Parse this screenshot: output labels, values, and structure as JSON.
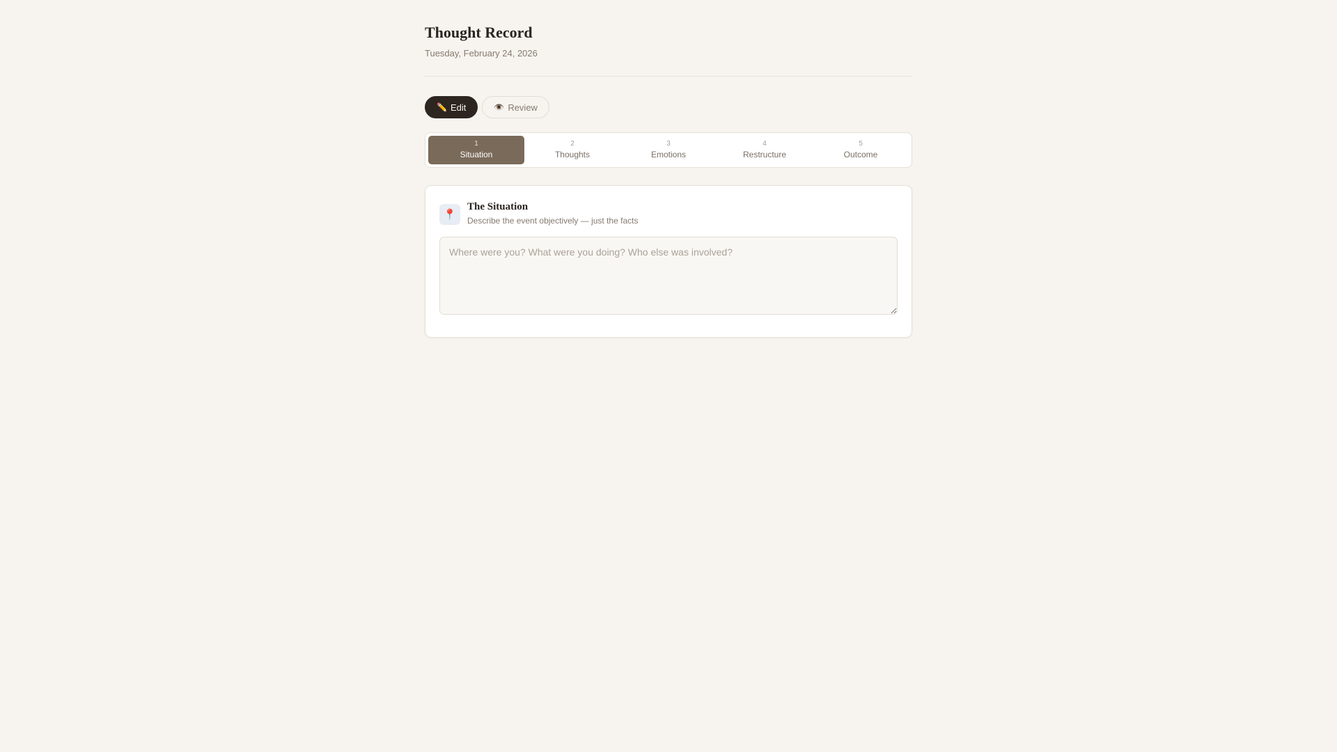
{
  "header": {
    "title": "Thought Record",
    "date": "Tuesday, February 24, 2026"
  },
  "modes": {
    "edit": {
      "icon": "✏️",
      "label": "Edit"
    },
    "review": {
      "icon": "👁️",
      "label": "Review"
    },
    "active": "edit"
  },
  "steps": [
    {
      "num": "1",
      "label": "Situation"
    },
    {
      "num": "2",
      "label": "Thoughts"
    },
    {
      "num": "3",
      "label": "Emotions"
    },
    {
      "num": "4",
      "label": "Restructure"
    },
    {
      "num": "5",
      "label": "Outcome"
    }
  ],
  "active_step": 0,
  "section": {
    "icon": "📍",
    "title": "The Situation",
    "subtitle": "Describe the event objectively — just the facts",
    "input_value": "",
    "placeholder": "Where were you? What were you doing? Who else was involved?"
  },
  "colors": {
    "background": "#f7f4ef",
    "active_step": "#7a6a59",
    "active_mode": "#2d2520"
  }
}
